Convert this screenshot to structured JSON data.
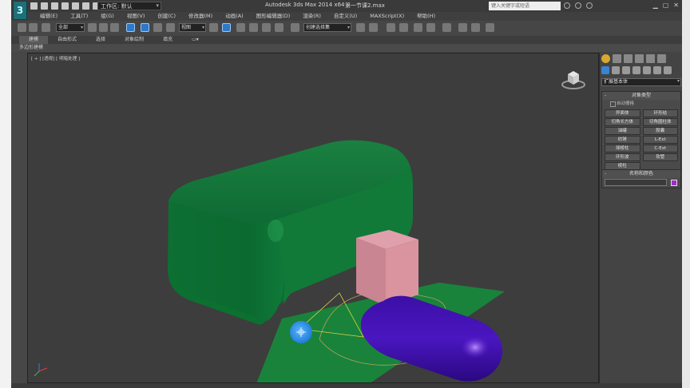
{
  "app": {
    "logo": "3",
    "workspace": "工作区: 默认",
    "title": "Autodesk 3ds Max  2014 x64",
    "file": "第一节课2.max",
    "search_placeholder": "键入关键字或短语"
  },
  "menu": [
    "编辑(E)",
    "工具(T)",
    "组(G)",
    "视图(V)",
    "创建(C)",
    "修改器(M)",
    "动画(A)",
    "图形编辑器(D)",
    "渲染(R)",
    "自定义(U)",
    "MAXScript(X)",
    "帮助(H)"
  ],
  "toolbar": {
    "selection_filter": "全部",
    "reference_coord": "视图",
    "named_selection": "创建选择集"
  },
  "ribbon": {
    "tabs": [
      "建模",
      "自由形式",
      "选择",
      "对象绘制",
      "填充"
    ],
    "sub_label": "多边形建模"
  },
  "viewport": {
    "label": "[ + ] [透视] [ 明暗处理 ]"
  },
  "command_panel": {
    "category": "扩展基本体",
    "object_type_header": "对象类型",
    "auto_grid": "自动栅格",
    "buttons": [
      "异面体",
      "环形结",
      "切角长方体",
      "切角圆柱体",
      "油罐",
      "胶囊",
      "纺锤",
      "L-Ext",
      "球棱柱",
      "C-Ext",
      "环形波",
      "软管",
      "棱柱"
    ],
    "name_color_header": "名称和颜色",
    "object_color": "#9b2fc6"
  },
  "scene_colors": {
    "box": "#1d8a45",
    "plane": "#1e8a3e",
    "pink_box": "#d28c9a",
    "capsule": "#5a1fc9",
    "background": "#3d3d3d"
  }
}
